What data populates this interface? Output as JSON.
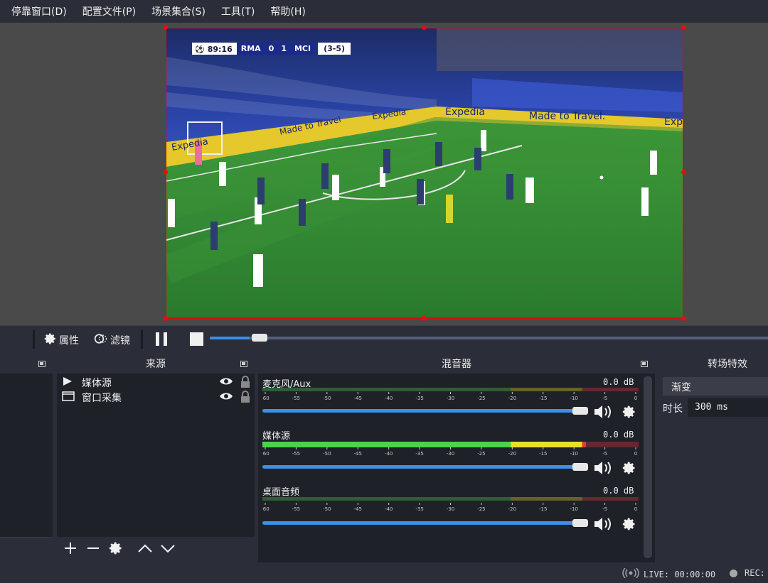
{
  "menu": [
    "停靠窗口(D)",
    "配置文件(P)",
    "场景集合(S)",
    "工具(T)",
    "帮助(H)"
  ],
  "scorebug": {
    "clock": "89:16",
    "home": "RMA",
    "home_score": "0",
    "away_score": "1",
    "away": "MCI",
    "aggregate": "(3-5)"
  },
  "pitch_boards": {
    "left_board": "Expedia",
    "slogan1": "Made to Travel",
    "board2": "Expedia",
    "board3": "Expedia",
    "slogan2": "Made to Travel.",
    "board4": "Exp"
  },
  "controls": {
    "properties_label": "属性",
    "filters_label": "滤镜",
    "seek_progress": 0.09
  },
  "docks": {
    "sources_title": "来源",
    "mixer_title": "混音器",
    "transitions_title": "转场特效"
  },
  "sources": [
    {
      "label": "媒体源",
      "icon": "play-icon"
    },
    {
      "label": "窗口采集",
      "icon": "window-icon"
    }
  ],
  "mixer": {
    "tick_labels": [
      "-60",
      "-55",
      "-50",
      "-45",
      "-40",
      "-35",
      "-30",
      "-25",
      "-20",
      "-15",
      "-10",
      "-5",
      "0"
    ],
    "channels": [
      {
        "name": "麦克风/Aux",
        "db": "0.0 dB",
        "level": 0,
        "volume": 1.0
      },
      {
        "name": "媒体源",
        "db": "0.0 dB",
        "level": 0.86,
        "volume": 1.0
      },
      {
        "name": "桌面音频",
        "db": "0.0 dB",
        "level": 0,
        "volume": 1.0
      }
    ]
  },
  "transition": {
    "type": "渐变",
    "duration_label": "时长",
    "duration_value": "300 ms"
  },
  "status": {
    "live": "LIVE: 00:00:00",
    "rec": "REC:"
  },
  "colors": {
    "selection": "#d01010",
    "accent": "#3d8fe8",
    "meter_green": "#4cd24c",
    "meter_yellow": "#e8e02a",
    "meter_red": "#e03a3a",
    "pitch": "#2e8a34"
  }
}
